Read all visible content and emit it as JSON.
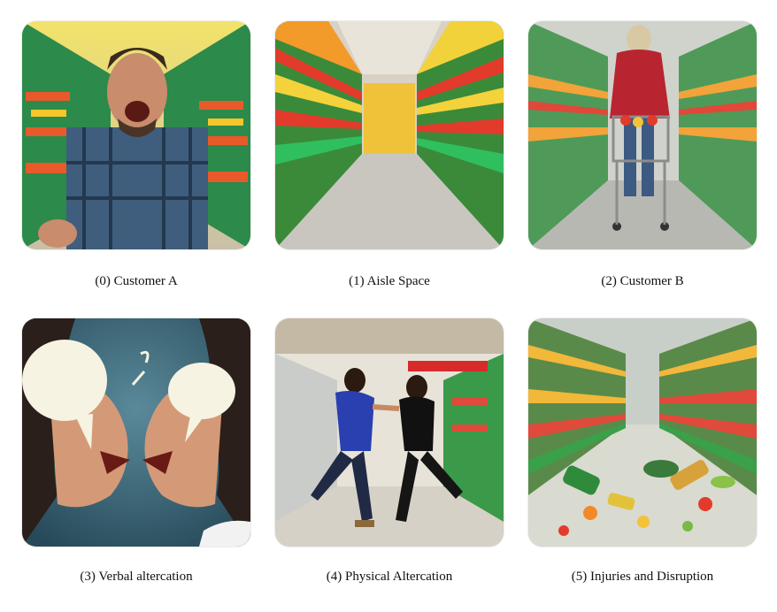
{
  "panels": [
    {
      "caption": "(0) Customer A",
      "image": "angry-man-in-aisle"
    },
    {
      "caption": "(1) Aisle Space",
      "image": "empty-grocery-aisle"
    },
    {
      "caption": "(2) Customer B",
      "image": "woman-with-cart"
    },
    {
      "caption": "(3) Verbal altercation",
      "image": "two-faces-shouting"
    },
    {
      "caption": "(4) Physical Altercation",
      "image": "two-people-fighting"
    },
    {
      "caption": "(5) Injuries and Disruption",
      "image": "spilled-groceries-aisle"
    }
  ]
}
